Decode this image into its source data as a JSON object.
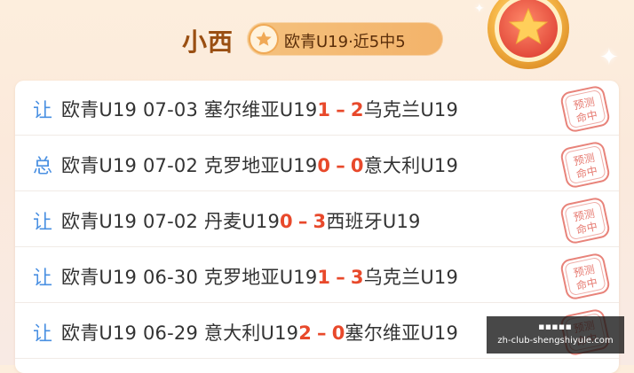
{
  "header": {
    "name": "小西",
    "pill_text": "欧青U19·近5中5"
  },
  "rows": [
    {
      "tag": "让",
      "league": "欧青U19",
      "date": "07-03",
      "home": "塞尔维亚U19",
      "home_score": "1",
      "away_score": "2",
      "away": "乌克兰U19",
      "stamp_line1": "预测",
      "stamp_line2": "命中"
    },
    {
      "tag": "总",
      "league": "欧青U19",
      "date": "07-02",
      "home": "克罗地亚U19",
      "home_score": "0",
      "away_score": "0",
      "away": "意大利U19",
      "stamp_line1": "预测",
      "stamp_line2": "命中"
    },
    {
      "tag": "让",
      "league": "欧青U19",
      "date": "07-02",
      "home": "丹麦U19",
      "home_score": "0",
      "away_score": "3",
      "away": "西班牙U19",
      "stamp_line1": "预测",
      "stamp_line2": "命中"
    },
    {
      "tag": "让",
      "league": "欧青U19",
      "date": "06-30",
      "home": "克罗地亚U19",
      "home_score": "1",
      "away_score": "3",
      "away": "乌克兰U19",
      "stamp_line1": "预测",
      "stamp_line2": "命中"
    },
    {
      "tag": "让",
      "league": "欧青U19",
      "date": "06-29",
      "home": "意大利U19",
      "home_score": "2",
      "away_score": "0",
      "away": "塞尔维亚U19",
      "stamp_line1": "预测",
      "stamp_line2": "命中"
    }
  ],
  "score_separator": "–",
  "watermark": {
    "line1": "■■■■■",
    "line2": "zh-club-shengshiyule.com"
  },
  "colors": {
    "accent_blue": "#4a90e2",
    "score_red": "#e8492b",
    "title_brown": "#9a4f12",
    "stamp_red": "#e05a4e"
  }
}
